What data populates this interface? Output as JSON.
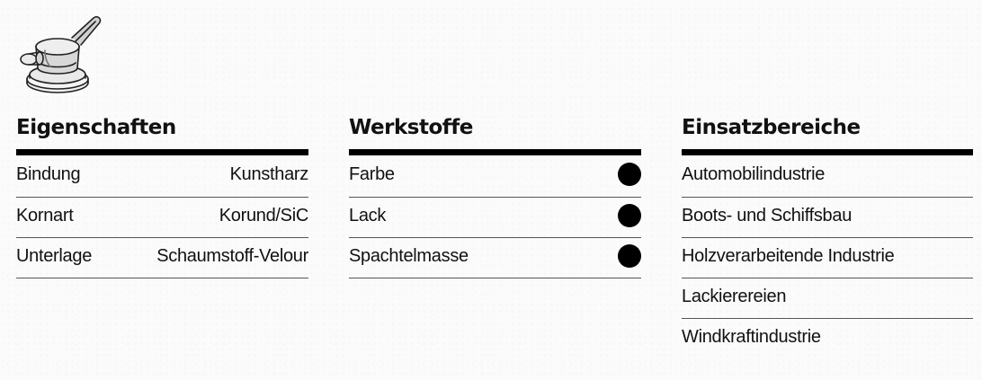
{
  "eigenschaften": {
    "heading": "Eigenschaften",
    "rows": [
      {
        "label": "Bindung",
        "value": "Kunstharz"
      },
      {
        "label": "Kornart",
        "value": "Korund/SiC"
      },
      {
        "label": "Unterlage",
        "value": "Schaumstoff-Velour"
      }
    ]
  },
  "werkstoffe": {
    "heading": "Werkstoffe",
    "rows": [
      {
        "label": "Farbe",
        "indicator": "filled-circle"
      },
      {
        "label": "Lack",
        "indicator": "filled-circle"
      },
      {
        "label": "Spachtelmasse",
        "indicator": "filled-circle"
      }
    ]
  },
  "einsatzbereiche": {
    "heading": "Einsatzbereiche",
    "rows": [
      {
        "label": "Automobilindustrie"
      },
      {
        "label": "Boots- und Schiffsbau"
      },
      {
        "label": "Holzverarbeitende Industrie"
      },
      {
        "label": "Lackierereien"
      },
      {
        "label": "Windkraftindustrie"
      }
    ]
  },
  "icons": {
    "tool": "random-orbital-sander-icon"
  }
}
